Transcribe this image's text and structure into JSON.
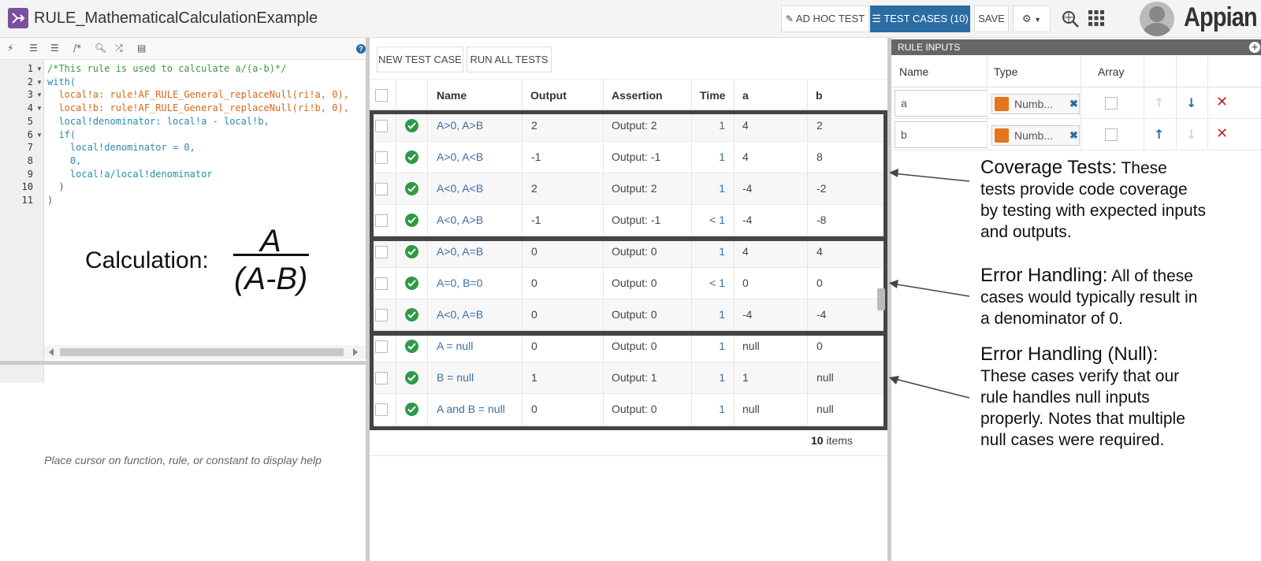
{
  "header": {
    "title": "RULE_MathematicalCalculationExample",
    "ad_hoc_label": "AD HOC TEST",
    "test_cases_label": "TEST CASES (10)",
    "save_label": "SAVE",
    "brand": "Appian"
  },
  "editor": {
    "line_numbers": [
      "1",
      "2",
      "3",
      "4",
      "5",
      "6",
      "7",
      "8",
      "9",
      "10",
      "11"
    ],
    "code_lines": [
      "/*This rule is used to calculate a/(a-b)*/",
      "with(",
      "  local!a: rule!AF_RULE_General_replaceNull(ri!a, 0),",
      "  local!b: rule!AF_RULE_General_replaceNull(ri!b, 0),",
      "  local!denominator: local!a - local!b,",
      "  if(",
      "    local!denominator = 0,",
      "    0,",
      "    local!a/local!denominator",
      "  )",
      ")"
    ],
    "calc_label": "Calculation:",
    "calc_numerator": "A",
    "calc_denominator": "(A-B)",
    "help_text": "Place cursor on function, rule, or constant to display help"
  },
  "tests": {
    "new_label": "NEW TEST CASE",
    "run_label": "RUN ALL TESTS",
    "columns": [
      "Name",
      "Output",
      "Assertion",
      "Time",
      "a",
      "b"
    ],
    "rows": [
      {
        "name": "A>0, A>B",
        "output": "2",
        "assertion": "Output: 2",
        "time": "1",
        "a": "4",
        "b": "2"
      },
      {
        "name": "A>0, A<B",
        "output": "-1",
        "assertion": "Output: -1",
        "time": "1",
        "a": "4",
        "b": "8"
      },
      {
        "name": "A<0, A<B",
        "output": "2",
        "assertion": "Output: 2",
        "time": "1",
        "a": "-4",
        "b": "-2"
      },
      {
        "name": "A<0, A>B",
        "output": "-1",
        "assertion": "Output: -1",
        "time": "< 1",
        "a": "-4",
        "b": "-8"
      },
      {
        "name": "A>0, A=B",
        "output": "0",
        "assertion": "Output: 0",
        "time": "1",
        "a": "4",
        "b": "4"
      },
      {
        "name": "A=0, B=0",
        "output": "0",
        "assertion": "Output: 0",
        "time": "< 1",
        "a": "0",
        "b": "0"
      },
      {
        "name": "A<0, A=B",
        "output": "0",
        "assertion": "Output: 0",
        "time": "1",
        "a": "-4",
        "b": "-4"
      },
      {
        "name": "A = null",
        "output": "0",
        "assertion": "Output: 0",
        "time": "1",
        "a": "null",
        "b": "0"
      },
      {
        "name": "B = null",
        "output": "1",
        "assertion": "Output: 1",
        "time": "1",
        "a": "1",
        "b": "null"
      },
      {
        "name": "A and B = null",
        "output": "0",
        "assertion": "Output: 0",
        "time": "1",
        "a": "null",
        "b": "null"
      }
    ],
    "item_count": "10",
    "items_word": "items"
  },
  "rule_inputs": {
    "header": "RULE INPUTS",
    "columns": [
      "Name",
      "Type",
      "Array"
    ],
    "rows": [
      {
        "name": "a",
        "type": "Numb..."
      },
      {
        "name": "b",
        "type": "Numb..."
      }
    ]
  },
  "annotations": [
    {
      "heading": "Coverage Tests:",
      "body_first": " These",
      "body": [
        "tests provide code coverage",
        "by testing with expected inputs",
        "and outputs."
      ]
    },
    {
      "heading": "Error Handling:",
      "body_first": " All of these",
      "body": [
        "cases would typically result in",
        "a denominator of 0."
      ]
    },
    {
      "heading": "Error Handling (Null):",
      "body_first": "",
      "body": [
        "These cases verify that our",
        "rule handles null inputs",
        "properly. Notes that multiple",
        "null cases were required."
      ]
    }
  ],
  "colors": {
    "primary": "#2b6ca3",
    "success": "#2e9a47",
    "delete": "#c8232c",
    "brand_icon": "#7a4fa0"
  }
}
